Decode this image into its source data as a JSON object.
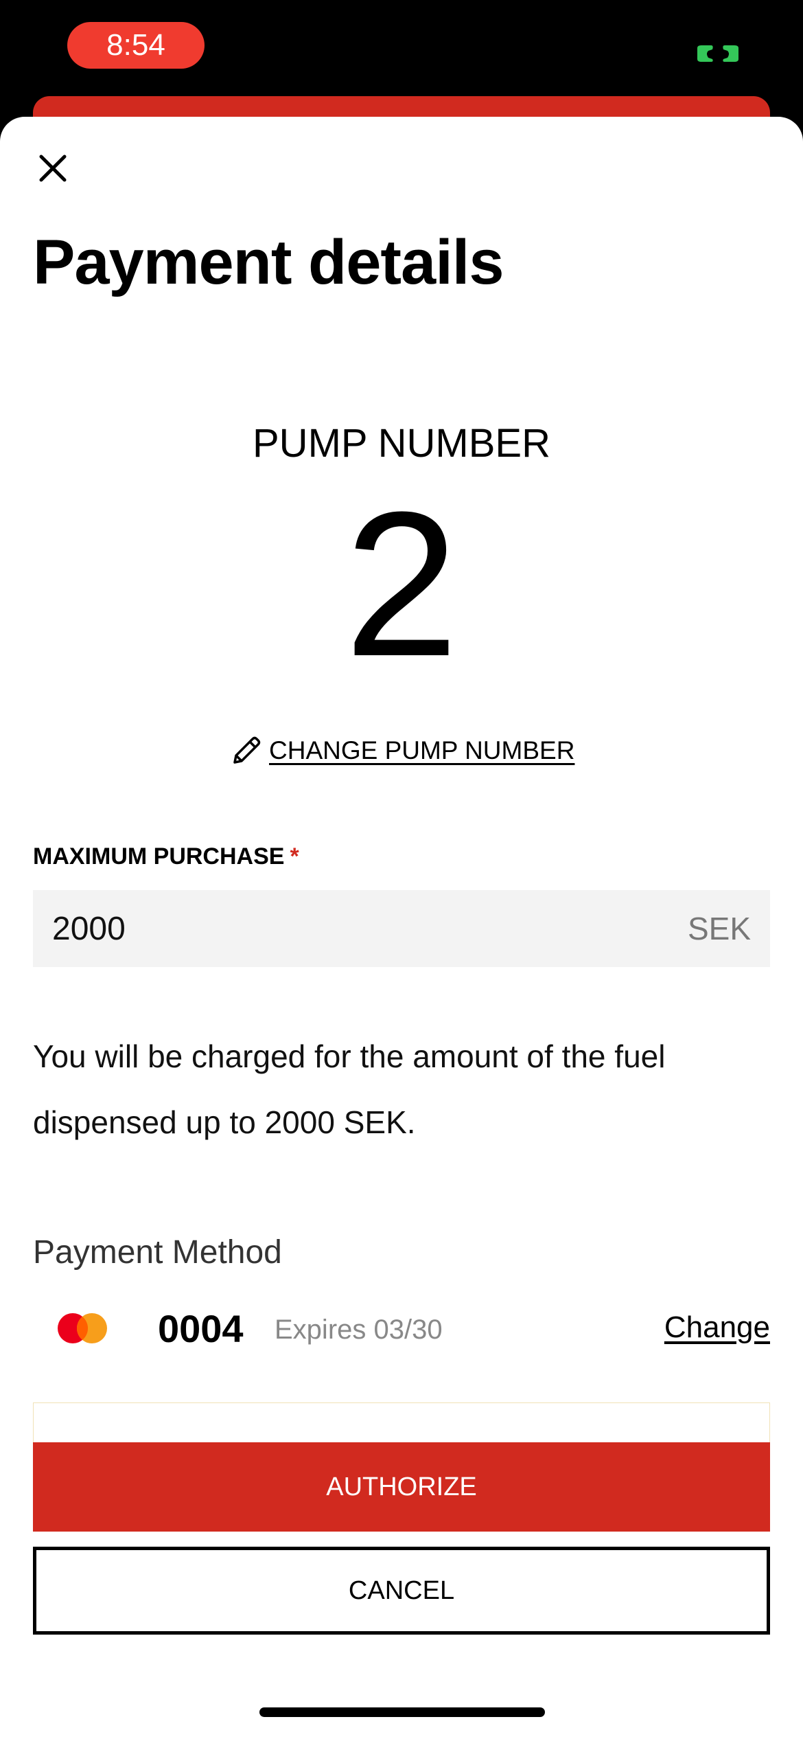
{
  "status_bar": {
    "time": "8:54",
    "time_pill_color": "#f03b2f",
    "call_indicator_color": "#34c759"
  },
  "sheet": {
    "close_icon": "close-icon",
    "title": "Payment details"
  },
  "pump": {
    "label": "PUMP NUMBER",
    "number": "2",
    "change_label": "CHANGE PUMP NUMBER",
    "change_icon": "pencil-icon"
  },
  "max_purchase": {
    "label": "MAXIMUM PURCHASE",
    "required_marker": "*",
    "value": "2000",
    "currency": "SEK"
  },
  "charge_note": "You will be charged for the amount of the fuel dispensed up to 2000 SEK.",
  "payment_method": {
    "heading": "Payment Method",
    "card_brand_icon": "mastercard-icon",
    "card_last4": "0004",
    "expiry": "Expires 03/30",
    "change_label": "Change"
  },
  "actions": {
    "authorize_label": "AUTHORIZE",
    "cancel_label": "CANCEL"
  },
  "colors": {
    "brand_red": "#d12a1f"
  }
}
